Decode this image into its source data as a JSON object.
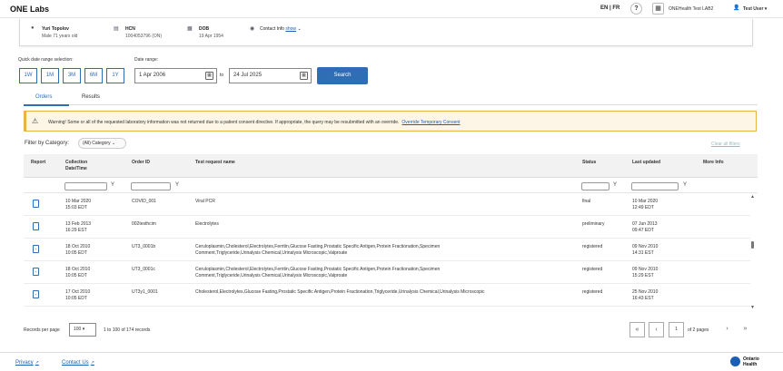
{
  "header": {
    "app_title": "ONE Labs",
    "lang_en": "EN",
    "lang_sep": "|",
    "lang_fr": "FR",
    "help_symbol": "?",
    "org_name": "ONEHealth Test LAB2",
    "user_name": "Test User"
  },
  "patient": {
    "name": "Yuri Topolov",
    "sex_age": "Male 71 years old",
    "hcn_label": "HCN",
    "hcn_value": "1004053796 (ON)",
    "dob_label": "DOB",
    "dob_value": "19 Apr 1954",
    "contact_label": "Contact Info",
    "contact_link": "show"
  },
  "search": {
    "quick_label": "Quick date range selection:",
    "quick_options": [
      "1W",
      "1M",
      "3M",
      "6M",
      "1Y"
    ],
    "date_range_label": "Date range:",
    "from_value": "1 Apr 2006",
    "to_label": "to",
    "to_value": "24 Jul 2025",
    "search_button": "Search"
  },
  "tabs": [
    "Orders",
    "Results"
  ],
  "warning": {
    "text": "Warning! Some or all of the requested laboratory information was not returned due to a patient consent directive. If appropriate, the query may be resubmitted with an override.",
    "link": "Override Temporary Consent"
  },
  "filters": {
    "category_label": "Filter by Category:",
    "category_value": "(All) Category",
    "clear_all": "Clear all filters",
    "funnel_symbol": "Y"
  },
  "table": {
    "columns": {
      "report": "Report",
      "collection_l1": "Collection",
      "collection_l2": "Date/Time",
      "order_id": "Order ID",
      "test_request": "Test request name",
      "status": "Status",
      "last_updated": "Last updated",
      "more_info": "More Info"
    },
    "rows": [
      {
        "date": "10 Mar 2020",
        "time": "15:03 EDT",
        "order_id": "COVID_001",
        "test_l1": "Viral PCR",
        "test_l2": "",
        "status": "final",
        "updated_date": "10 Mar 2020",
        "updated_time": "12:49 EDT"
      },
      {
        "date": "13 Feb 2013",
        "time": "16:29 EST",
        "order_id": "002testhcim",
        "test_l1": "Electrolytes",
        "test_l2": "",
        "status": "preliminary",
        "updated_date": "07 Jun 2013",
        "updated_time": "09:47 EDT"
      },
      {
        "date": "18 Oct 2010",
        "time": "10:05 EDT",
        "order_id": "UT3_0001b",
        "test_l1": "Ceruloplasmin,Cholesterol,Electrolytes,Ferritin,Glucose Fasting,Prostatic Specific Antigen,Protein Fractionation,Specimen",
        "test_l2": "Comment,Triglyceride,Urinalysis Chemical,Urinalysis Microscopic,Valproate",
        "status": "registered",
        "updated_date": "09 Nov 2010",
        "updated_time": "14:31 EST"
      },
      {
        "date": "18 Oct 2010",
        "time": "10:05 EDT",
        "order_id": "UT3_0001c",
        "test_l1": "Ceruloplasmin,Cholesterol,Electrolytes,Ferritin,Glucose Fasting,Prostatic Specific Antigen,Protein Fractionation,Specimen",
        "test_l2": "Comment,Triglyceride,Urinalysis Chemical,Urinalysis Microscopic,Valproate",
        "status": "registered",
        "updated_date": "09 Nov 2010",
        "updated_time": "15:29 EST"
      },
      {
        "date": "17 Oct 2010",
        "time": "10:05 EDT",
        "order_id": "UT3y1_0001",
        "test_l1": "Cholesterol,Electrolytes,Glucose Fasting,Prostatic Specific Antigen,Protein Fractionation,Triglyceride,Urinalysis Chemical,Urinalysis Microscopic",
        "test_l2": "",
        "status": "registered",
        "updated_date": "25 Nov 2010",
        "updated_time": "16:43 EST"
      }
    ]
  },
  "pagination": {
    "per_page_label": "Records per page",
    "per_page_value": "100",
    "range_text": "1 to 100 of 174 records",
    "first": "«",
    "prev": "‹",
    "current_page": "1",
    "of_pages": "of 2 pages",
    "next": "›",
    "last": "»"
  },
  "footer": {
    "privacy": "Privacy",
    "contact": "Contact Us",
    "brand_line1": "Ontario",
    "brand_line2": "Health"
  },
  "colors": {
    "accent": "#2f6db5",
    "link": "#1a5fb4",
    "warning_border": "#e6b445",
    "warning_bg": "#fdf6e7"
  },
  "icons": [
    "person-icon",
    "card-icon",
    "calendar-icon",
    "location-icon",
    "help-icon",
    "building-icon",
    "user-icon",
    "warning-icon",
    "document-icon",
    "filter-icon",
    "external-link-icon"
  ]
}
